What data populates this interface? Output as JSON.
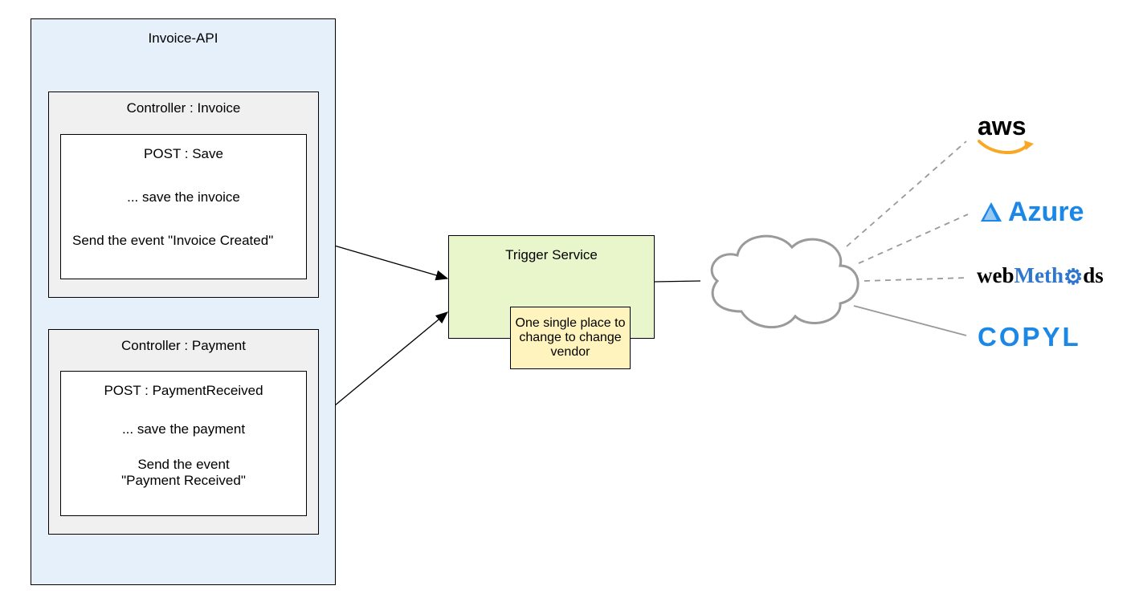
{
  "api": {
    "title": "Invoice-API",
    "controllers": [
      {
        "title": "Controller : Invoice",
        "action_title": "POST : Save",
        "action_step": "... save the invoice",
        "action_event": "Send the event \"Invoice Created\""
      },
      {
        "title": "Controller : Payment",
        "action_title": "POST : PaymentReceived",
        "action_step": "... save the payment",
        "action_event": "Send the event\n\"Payment Received\""
      }
    ]
  },
  "trigger": {
    "title": "Trigger Service",
    "note": "One single place to change to change vendor"
  },
  "vendors": {
    "aws": "aws",
    "azure": "Azure",
    "webmethods_web": "web",
    "webmethods_m": "M",
    "webmethods_eth": "eth",
    "webmethods_ds": "ds",
    "copyl": "COPYL"
  }
}
